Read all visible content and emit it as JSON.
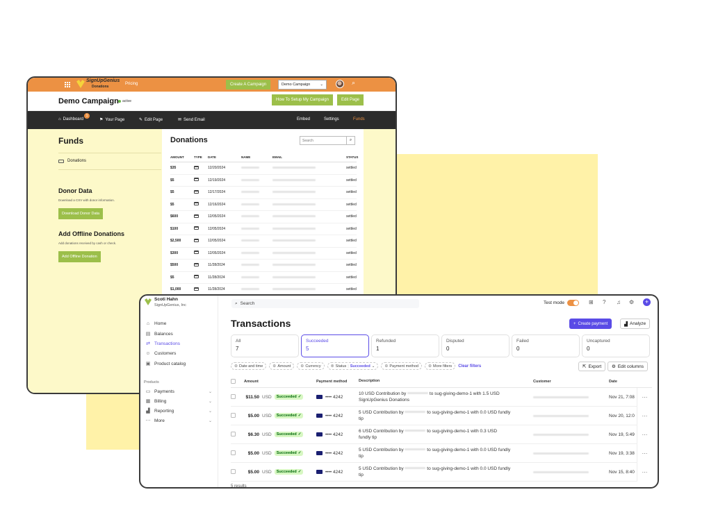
{
  "sug": {
    "logo_line1": "SignUpGenius",
    "logo_line2": "Donations",
    "pricing": "Pricing",
    "create_campaign": "Create A Campaign",
    "campaign_select": "Demo Campaign",
    "campaign_title": "Demo Campaign",
    "status": "active",
    "howto_btn": "How To Setup My Campaign",
    "edit_page_btn": "Edit Page",
    "nav": {
      "dashboard": "Dashboard",
      "dashboard_badge": "1",
      "your_page": "Your Page",
      "edit_page": "Edit Page",
      "send_email": "Send Email",
      "embed": "Embed",
      "settings": "Settings",
      "funds": "Funds"
    },
    "sidebar": {
      "title": "Funds",
      "item_donations": "Donations",
      "donor_title": "Donor Data",
      "donor_desc": "Download a CSV with donor information.",
      "download_btn": "Download Donor Data",
      "offline_title": "Add Offline Donations",
      "offline_desc": "Add donations received by cash or check.",
      "offline_btn": "Add Offline Donation"
    },
    "donations": {
      "title": "Donations",
      "search_placeholder": "Search",
      "headers": [
        "AMOUNT",
        "TYPE",
        "DATE",
        "NAME",
        "EMAIL",
        "STATUS"
      ],
      "rows": [
        {
          "amount": "$35",
          "date": "12/20/2024",
          "status": "settled"
        },
        {
          "amount": "$5",
          "date": "12/19/2024",
          "status": "settled"
        },
        {
          "amount": "$5",
          "date": "12/17/2024",
          "status": "settled"
        },
        {
          "amount": "$5",
          "date": "12/16/2024",
          "status": "settled"
        },
        {
          "amount": "$600",
          "date": "12/05/2024",
          "status": "settled"
        },
        {
          "amount": "$100",
          "date": "12/05/2024",
          "status": "settled"
        },
        {
          "amount": "$2,500",
          "date": "12/05/2024",
          "status": "settled"
        },
        {
          "amount": "$300",
          "date": "12/05/2024",
          "status": "settled"
        },
        {
          "amount": "$500",
          "date": "11/28/2024",
          "status": "settled"
        },
        {
          "amount": "$5",
          "date": "11/28/2024",
          "status": "settled"
        },
        {
          "amount": "$1,000",
          "date": "11/28/2024",
          "status": "settled"
        }
      ]
    }
  },
  "stripe": {
    "account_name": "Scoti Hahn",
    "account_org": "SignUpGenius, Inc",
    "search_placeholder": "Search",
    "test_mode": "Test mode",
    "nav": {
      "home": "Home",
      "balances": "Balances",
      "transactions": "Transactions",
      "customers": "Customers",
      "product_catalog": "Product catalog",
      "products_label": "Products",
      "payments": "Payments",
      "billing": "Billing",
      "reporting": "Reporting",
      "more": "More"
    },
    "page_title": "Transactions",
    "create_payment": "Create payment",
    "analyze": "Analyze",
    "tabs": [
      {
        "label": "All",
        "count": "7"
      },
      {
        "label": "Succeeded",
        "count": "5"
      },
      {
        "label": "Refunded",
        "count": "1"
      },
      {
        "label": "Disputed",
        "count": "0"
      },
      {
        "label": "Failed",
        "count": "0"
      },
      {
        "label": "Uncaptured",
        "count": "0"
      }
    ],
    "filters": {
      "date_time": "Date and time",
      "amount": "Amount",
      "currency": "Currency",
      "status": "Status",
      "status_value": "Succeeded",
      "payment_method": "Payment method",
      "more_filters": "More filters",
      "clear_filters": "Clear filters"
    },
    "export": "Export",
    "edit_columns": "Edit columns",
    "headers": {
      "amount": "Amount",
      "payment_method": "Payment method",
      "description": "Description",
      "customer": "Customer",
      "date": "Date"
    },
    "rows": [
      {
        "amount": "$11.50",
        "currency": "USD",
        "status": "Succeeded",
        "last4": "•••• 4242",
        "desc_a": "10 USD Contribution by",
        "desc_b": "to sug-giving-demo-1 with 1.5 USD",
        "desc_c": "SignUpGenius Donations",
        "date": "Nov 21, 7:08"
      },
      {
        "amount": "$5.00",
        "currency": "USD",
        "status": "Succeeded",
        "last4": "•••• 4242",
        "desc_a": "5 USD Contribution by",
        "desc_b": "to sug-giving-demo-1 with 0.0 USD fundly",
        "desc_c": "tip",
        "date": "Nov 20, 12:0"
      },
      {
        "amount": "$6.30",
        "currency": "USD",
        "status": "Succeeded",
        "last4": "•••• 4242",
        "desc_a": "6 USD Contribution by",
        "desc_b": "to sug-giving-demo-1 with 0.3 USD",
        "desc_c": "fundly tip",
        "date": "Nov 19, 5:49"
      },
      {
        "amount": "$5.00",
        "currency": "USD",
        "status": "Succeeded",
        "last4": "•••• 4242",
        "desc_a": "5 USD Contribution by",
        "desc_b": "to sug-giving-demo-1 with 0.0 USD fundly",
        "desc_c": "tip",
        "date": "Nov 19, 3:38"
      },
      {
        "amount": "$5.00",
        "currency": "USD",
        "status": "Succeeded",
        "last4": "•••• 4242",
        "desc_a": "5 USD Contribution by",
        "desc_b": "to sug-giving-demo-1 with 0.0 USD fundly",
        "desc_c": "tip",
        "date": "Nov 15, 8:40"
      }
    ],
    "results": "5 results"
  }
}
